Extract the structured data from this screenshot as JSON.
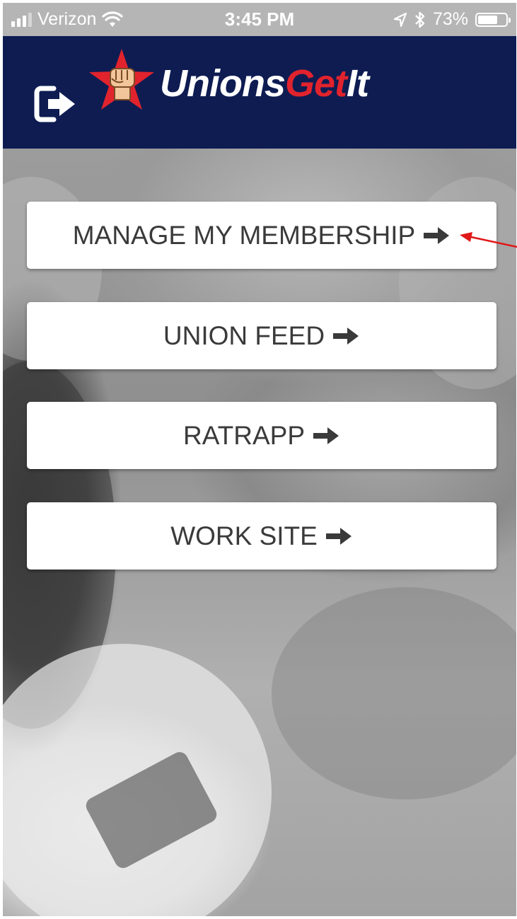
{
  "status_bar": {
    "carrier": "Verizon",
    "time": "3:45 PM",
    "battery": "73%",
    "battery_level": 0.73
  },
  "header": {
    "logo_part_a": "Unions",
    "logo_part_b": "Get",
    "logo_part_c": "It",
    "colors": {
      "background": "#0e1c52",
      "accent": "#e1232d"
    }
  },
  "menu": {
    "items": [
      {
        "label": "MANAGE MY MEMBERSHIP"
      },
      {
        "label": "UNION FEED"
      },
      {
        "label": "RATRAPP"
      },
      {
        "label": "WORK SITE"
      }
    ]
  },
  "icons": [
    "signal-icon",
    "wifi-icon",
    "location-icon",
    "bluetooth-icon",
    "battery-icon",
    "logout-icon",
    "fist-star-icon",
    "arrow-right-icon"
  ]
}
